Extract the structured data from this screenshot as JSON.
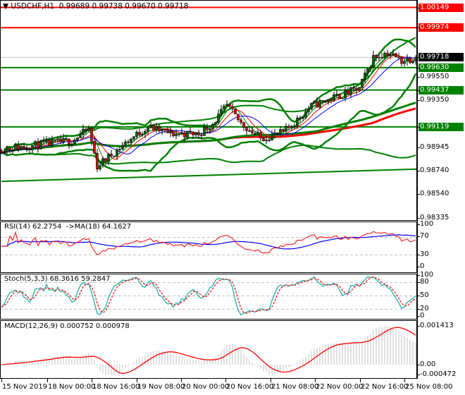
{
  "header": {
    "symbol": "USDCHF,H1",
    "ohlc": "0.99689 0.99738 0.99670 0.99718",
    "menu_icon": "triangle-down-icon"
  },
  "price_axis": {
    "ticks": [
      "0.99550",
      "0.99350",
      "0.98945",
      "0.98740",
      "0.98540",
      "0.98335"
    ],
    "levels": [
      {
        "value": "1.00149",
        "color": "#ff0000",
        "kind": "resistance"
      },
      {
        "value": "0.99974",
        "color": "#ff0000",
        "kind": "resistance"
      },
      {
        "value": "0.99718",
        "color": "#000000",
        "kind": "bid"
      },
      {
        "value": "0.99630",
        "color": "#008000",
        "kind": "support"
      },
      {
        "value": "0.99437",
        "color": "#008000",
        "kind": "support"
      },
      {
        "value": "0.99119",
        "color": "#008000",
        "kind": "support"
      }
    ]
  },
  "time_axis": [
    "15 Nov 2019",
    "18 Nov 00:00",
    "18 Nov 16:00",
    "19 Nov 08:00",
    "20 Nov 00:00",
    "20 Nov 16:00",
    "21 Nov 08:00",
    "22 Nov 00:00",
    "22 Nov 16:00",
    "25 Nov 08:00"
  ],
  "rsi": {
    "label": "RSI(14) 62.2754  ->MA(18) 64.1627",
    "ticks": [
      "100",
      "70",
      "30",
      "0"
    ]
  },
  "stoch": {
    "label": "Stoch(5,3,3) 68.3616 59.2847",
    "ticks": [
      "100",
      "80",
      "50",
      "20",
      "0"
    ]
  },
  "macd": {
    "label": "MACD(12,26,9) 0.000752 0.000978",
    "ticks": [
      "0.001413",
      "0.00",
      "-0.000472"
    ]
  },
  "colors": {
    "bull": "#006400",
    "bear": "#e00000",
    "bands": "#008000",
    "rsi": "#ff0000",
    "rsi_ma": "#0000ff",
    "stoch_main": "#20b2aa",
    "stoch_signal": "#ff0000",
    "macd_hist": "#c0c0c0",
    "macd_signal": "#ff0000"
  },
  "chart_data": {
    "type": "candlestick",
    "symbol": "USDCHF",
    "timeframe": "H1",
    "bars": 148,
    "ylim": [
      0.98316,
      1.00213
    ],
    "close_anchors": [
      [
        0,
        0.9893
      ],
      [
        12,
        0.9896
      ],
      [
        25,
        0.99
      ],
      [
        31,
        0.991
      ],
      [
        34,
        0.9878
      ],
      [
        45,
        0.99
      ],
      [
        52,
        0.9912
      ],
      [
        60,
        0.9906
      ],
      [
        70,
        0.9906
      ],
      [
        75,
        0.9915
      ],
      [
        80,
        0.993
      ],
      [
        85,
        0.9915
      ],
      [
        92,
        0.9902
      ],
      [
        100,
        0.9907
      ],
      [
        105,
        0.9918
      ],
      [
        110,
        0.993
      ],
      [
        120,
        0.9939
      ],
      [
        127,
        0.9945
      ],
      [
        132,
        0.9972
      ],
      [
        137,
        0.9976
      ],
      [
        142,
        0.9969
      ],
      [
        147,
        0.99718
      ]
    ],
    "trendline": [
      [
        0,
        0.9865
      ],
      [
        147,
        0.98755
      ]
    ]
  }
}
